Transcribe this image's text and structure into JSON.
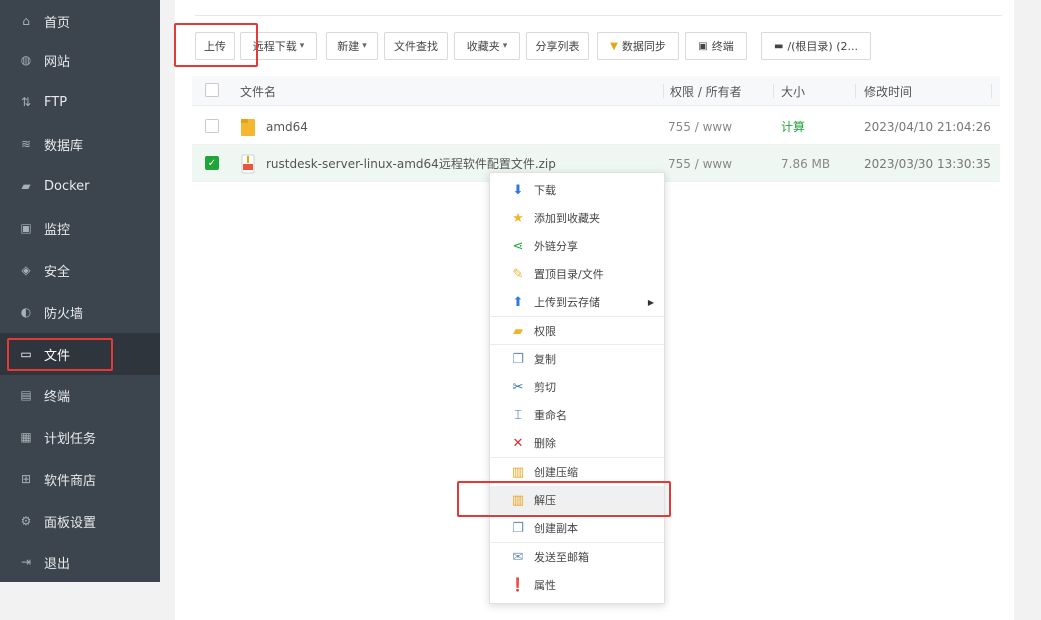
{
  "sidebar": {
    "items": [
      {
        "label": "首页",
        "icon": "home-icon"
      },
      {
        "label": "网站",
        "icon": "globe-icon"
      },
      {
        "label": "FTP",
        "icon": "ftp-icon"
      },
      {
        "label": "数据库",
        "icon": "database-icon"
      },
      {
        "label": "Docker",
        "icon": "docker-icon"
      },
      {
        "label": "监控",
        "icon": "monitor-icon"
      },
      {
        "label": "安全",
        "icon": "shield-icon"
      },
      {
        "label": "防火墙",
        "icon": "firewall-icon"
      },
      {
        "label": "文件",
        "icon": "folder-icon"
      },
      {
        "label": "终端",
        "icon": "terminal-icon"
      },
      {
        "label": "计划任务",
        "icon": "calendar-icon"
      },
      {
        "label": "软件商店",
        "icon": "apps-icon"
      },
      {
        "label": "面板设置",
        "icon": "gear-icon"
      },
      {
        "label": "退出",
        "icon": "logout-icon"
      }
    ],
    "active": "文件"
  },
  "toolbar": {
    "upload": "上传",
    "remote_download": "远程下载",
    "new": "新建",
    "file_search": "文件查找",
    "favorites": "收藏夹",
    "share_list": "分享列表",
    "data_sync": "数据同步",
    "terminal": "终端",
    "path": "/(根目录) (2..."
  },
  "table": {
    "headers": {
      "name": "文件名",
      "perm_owner": "权限 / 所有者",
      "size": "大小",
      "mtime": "修改时间"
    },
    "rows": [
      {
        "name": "amd64",
        "perm": "755 / www",
        "size": "计算",
        "mtime": "2023/04/10 21:04:26"
      },
      {
        "name": "rustdesk-server-linux-amd64远程软件配置文件.zip",
        "perm": "755 / www",
        "size": "7.86 MB",
        "mtime": "2023/03/30 13:30:35"
      }
    ]
  },
  "context_menu": {
    "download": "下载",
    "add_favorite": "添加到收藏夹",
    "share_link": "外链分享",
    "pin_top": "置顶目录/文件",
    "upload_cloud": "上传到云存储",
    "permission": "权限",
    "copy": "复制",
    "cut": "剪切",
    "rename": "重命名",
    "delete": "删除",
    "compress": "创建压缩",
    "extract": "解压",
    "duplicate": "创建副本",
    "send_email": "发送至邮箱",
    "properties": "属性"
  },
  "colors": {
    "sidebar_bg": "#3c444d",
    "accent_green": "#20a53a",
    "highlight_red": "#e53935"
  }
}
